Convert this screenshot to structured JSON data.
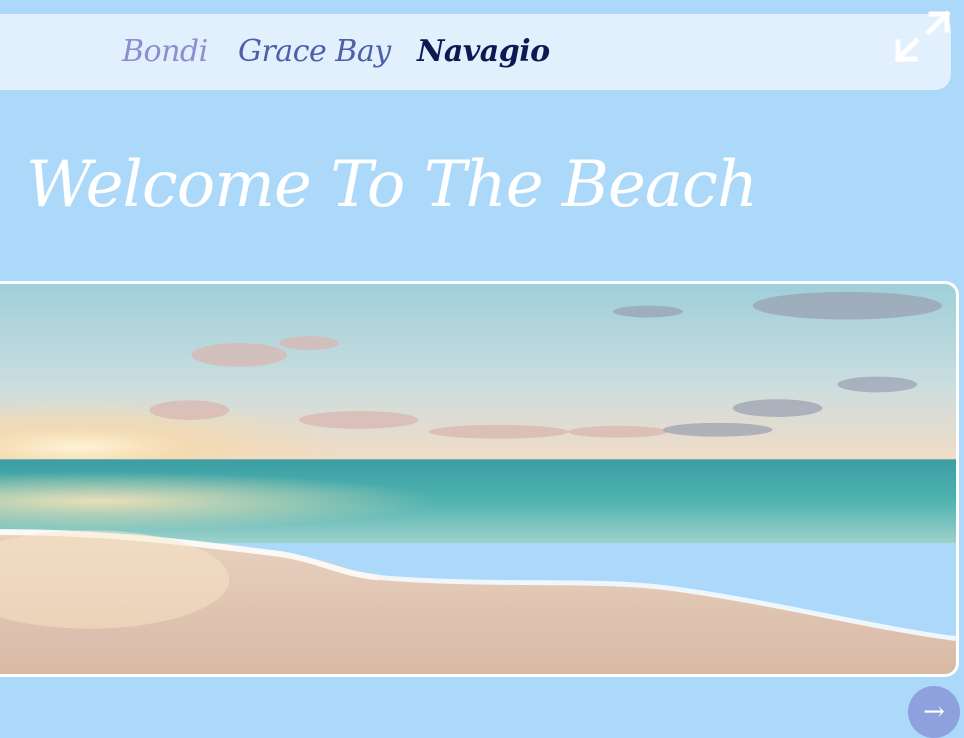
{
  "nav": {
    "links": [
      {
        "label": "Bondi"
      },
      {
        "label": "Grace Bay"
      },
      {
        "label": "Navagio"
      }
    ],
    "active_index": 2,
    "expand_icon": "expand-icon"
  },
  "hero": {
    "title": "Welcome To The Beach"
  },
  "photo": {
    "subject": "beach-sunset-photo"
  },
  "next_button": {
    "icon": "arrow-right-icon",
    "glyph": "→"
  },
  "colors": {
    "background": "#acd8f9",
    "nav_background": "#e2f0fd",
    "link_bondi": "#8b8fd0",
    "link_grace_bay": "#4a60a8",
    "link_active": "#0d1a52",
    "next_button": "#8fa0de"
  }
}
